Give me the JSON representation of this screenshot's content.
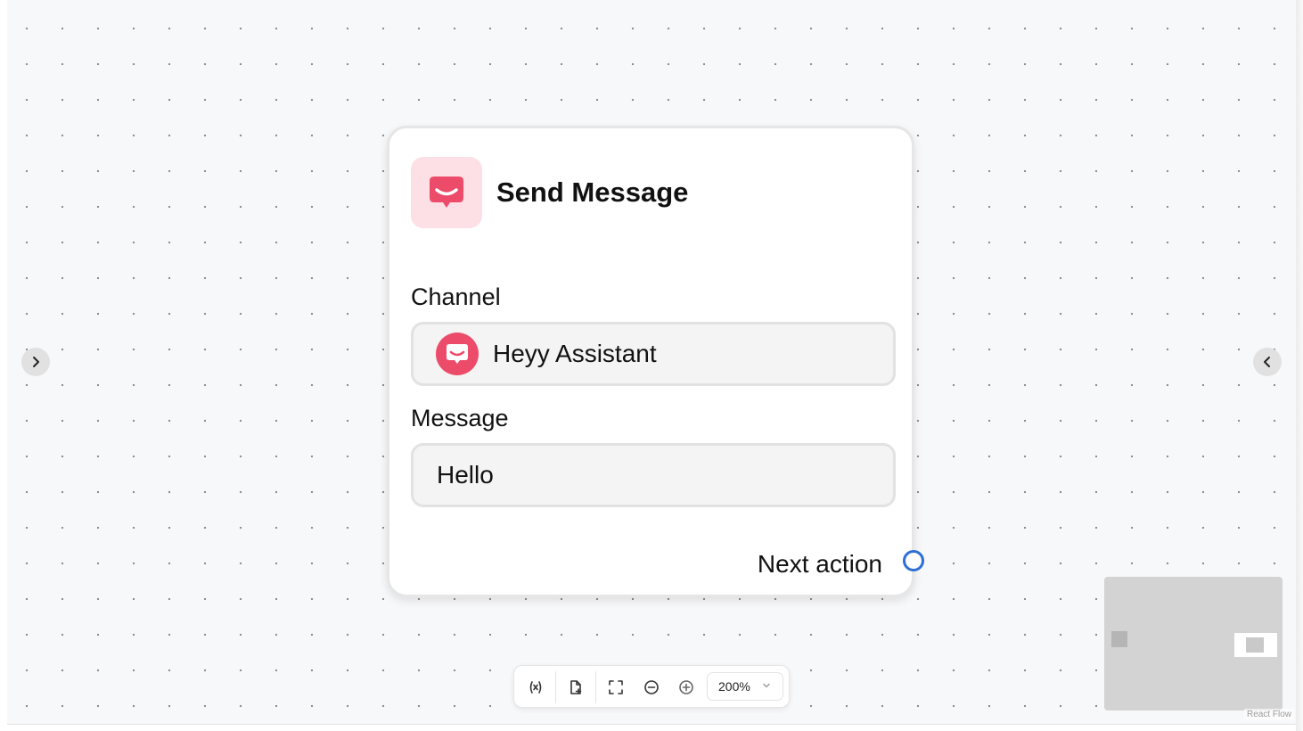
{
  "node": {
    "icon": "chat-bubble-icon",
    "title": "Send Message",
    "channel": {
      "label": "Channel",
      "value": "Heyy Assistant",
      "avatar_icon": "chat-bubble-icon"
    },
    "message": {
      "label": "Message",
      "value": "Hello"
    },
    "next_action_label": "Next action"
  },
  "side_toggles": {
    "left_icon": "chevron-right-icon",
    "right_icon": "chevron-left-icon"
  },
  "toolbar": {
    "items": [
      {
        "name": "variables-button",
        "icon": "variable-icon"
      },
      {
        "name": "add-note-button",
        "icon": "file-plus-icon"
      },
      {
        "name": "fit-view-button",
        "icon": "fullscreen-icon"
      },
      {
        "name": "zoom-out-button",
        "icon": "minus-circle-icon"
      },
      {
        "name": "zoom-in-button",
        "icon": "plus-circle-icon"
      }
    ],
    "zoom_level": "200%"
  },
  "attribution": "React Flow",
  "colors": {
    "accent": "#ec4b69",
    "icon_bg": "#fde0e5",
    "handle": "#2d6fd6",
    "canvas": "#f7f8fa"
  }
}
